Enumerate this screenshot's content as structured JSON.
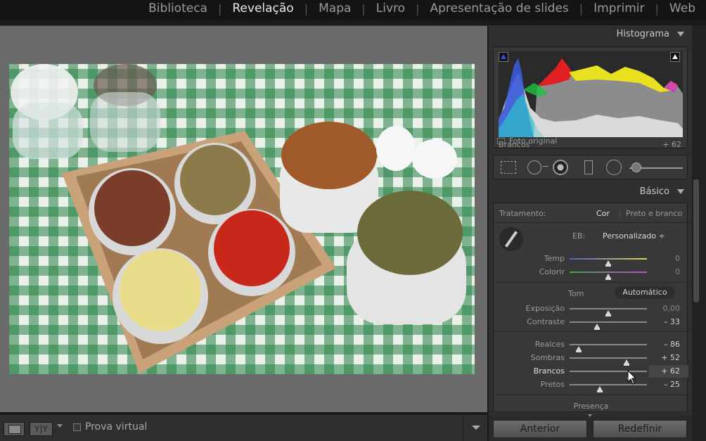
{
  "modules": [
    "Biblioteca",
    "Revelação",
    "Mapa",
    "Livro",
    "Apresentação de slides",
    "Imprimir",
    "Web"
  ],
  "active_module": "Revelação",
  "histogram": {
    "title": "Histograma",
    "hover_label": "Brancos",
    "hover_value": "+ 62",
    "original_photo_label": "Foto original"
  },
  "basic": {
    "title": "Básico",
    "treatment_label": "Tratamento:",
    "treatment_color": "Cor",
    "treatment_separator": "|",
    "treatment_bw": "Preto e branco",
    "wb_label": "EB:",
    "wb_value": "Personalizado ÷",
    "tone_label": "Tom",
    "auto_label": "Automático",
    "presence_label": "Presença",
    "sliders": [
      {
        "label": "Temp",
        "value": "0",
        "pos": 0.5
      },
      {
        "label": "Colorir",
        "value": "0",
        "pos": 0.5
      },
      {
        "label": "Exposição",
        "value": "0,00",
        "pos": 0.5
      },
      {
        "label": "Contraste",
        "value": "– 33",
        "pos": 0.35
      },
      {
        "label": "Realces",
        "value": "– 86",
        "pos": 0.12
      },
      {
        "label": "Sombras",
        "value": "+ 52",
        "pos": 0.74
      },
      {
        "label": "Brancos",
        "value": "+ 62",
        "pos": 0.78
      },
      {
        "label": "Pretos",
        "value": "– 25",
        "pos": 0.39
      }
    ]
  },
  "toolbar": {
    "soft_proof_label": "Prova virtual",
    "compare_label": "Y|Y"
  },
  "buttons": {
    "previous": "Anterior",
    "reset": "Redefinir"
  },
  "colors": {
    "panel_bg": "#2f2f2f",
    "accent_text": "#e0e0e0"
  }
}
